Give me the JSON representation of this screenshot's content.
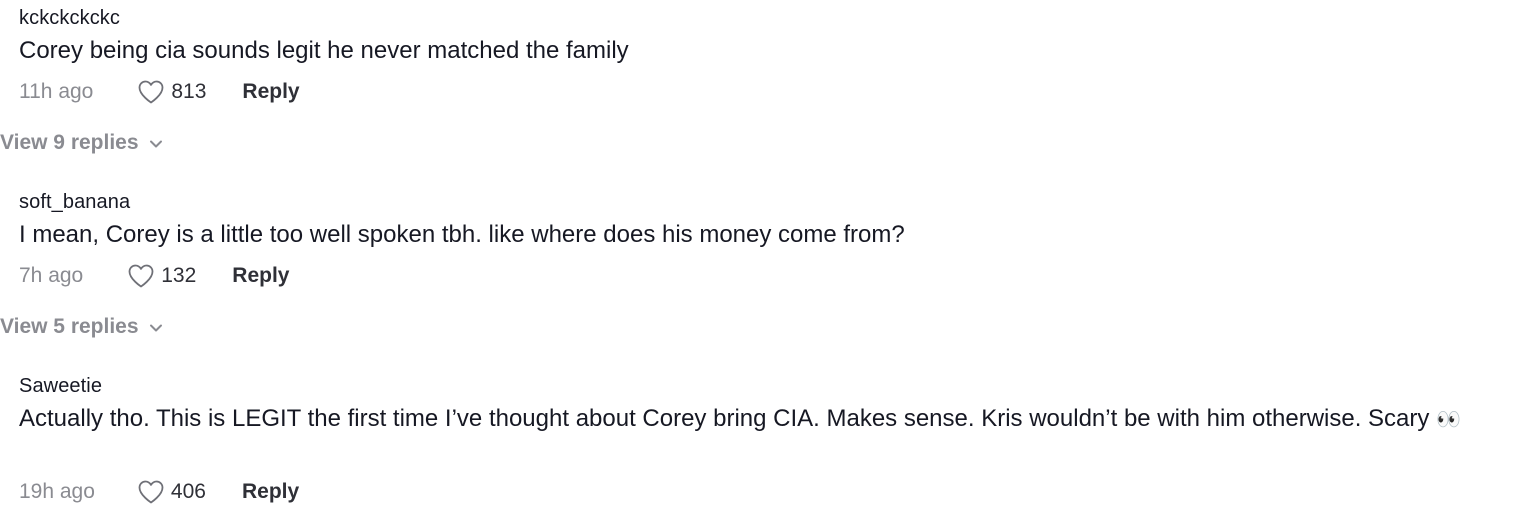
{
  "comments": [
    {
      "username": "kckckckckc",
      "text": "Corey being cia sounds legit he never matched the family",
      "timestamp": "11h ago",
      "likes": "813",
      "reply_label": "Reply",
      "view_replies": "View 9 replies"
    },
    {
      "username": "soft_banana",
      "text": "I mean, Corey is a little too well spoken tbh. like where does his money come from?",
      "timestamp": "7h ago",
      "likes": "132",
      "reply_label": "Reply",
      "view_replies": "View 5 replies"
    },
    {
      "username": "Saweetie",
      "text": "Actually tho. This is LEGIT the first time I’ve thought about Corey bring CIA. Makes sense. Kris wouldn’t be with him otherwise. Scary",
      "emoji": "👀",
      "timestamp": "19h ago",
      "likes": "406",
      "reply_label": "Reply"
    }
  ],
  "icons": {
    "like": "heart-outline-icon",
    "expand": "chevron-down-icon"
  },
  "colors": {
    "text_primary": "#161823",
    "text_secondary": "#8a8b91",
    "background": "#ffffff"
  }
}
